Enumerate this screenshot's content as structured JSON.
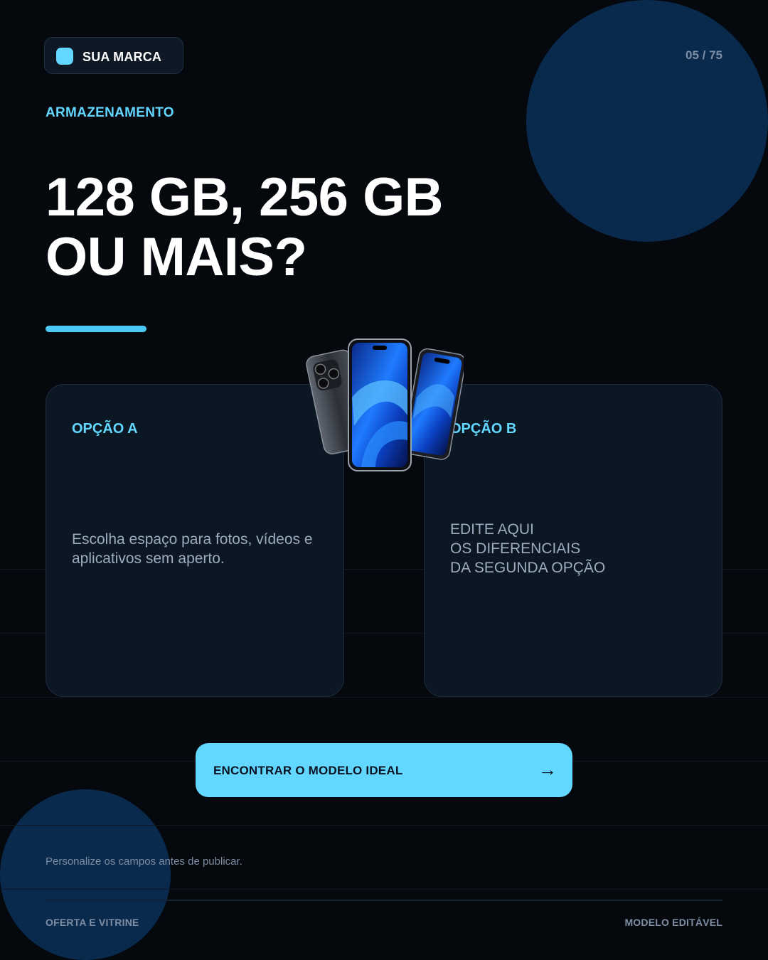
{
  "brand": {
    "label": "SUA MARCA"
  },
  "pagination": {
    "counter": "05 / 75"
  },
  "section": {
    "eyebrow": "ARMAZENAMENTO"
  },
  "hero": {
    "headline_line1": "128 GB, 256 GB",
    "headline_line2": "OU MAIS?"
  },
  "options": [
    {
      "title": "OPÇÃO A",
      "text": "Escolha espaço para fotos, vídeos e aplicativos sem aperto."
    },
    {
      "title": "OPÇÃO B",
      "text": "EDITE AQUI\nOS DIFERENCIAIS\nDA SEGUNDA OPÇÃO"
    }
  ],
  "cta": {
    "label": "ENCONTRAR O MODELO IDEAL",
    "arrow": "→"
  },
  "note": "Personalize os campos antes de publicar.",
  "footer": {
    "left": "OFERTA E VITRINE",
    "right": "MODELO EDITÁVEL"
  },
  "colors": {
    "background": "#05080d",
    "accent": "#62d7ff",
    "card": "#0c1724",
    "circle": "#0a2a4d"
  },
  "icons": {
    "cta": "arrow-right-icon",
    "brand": "brand-square-icon"
  }
}
